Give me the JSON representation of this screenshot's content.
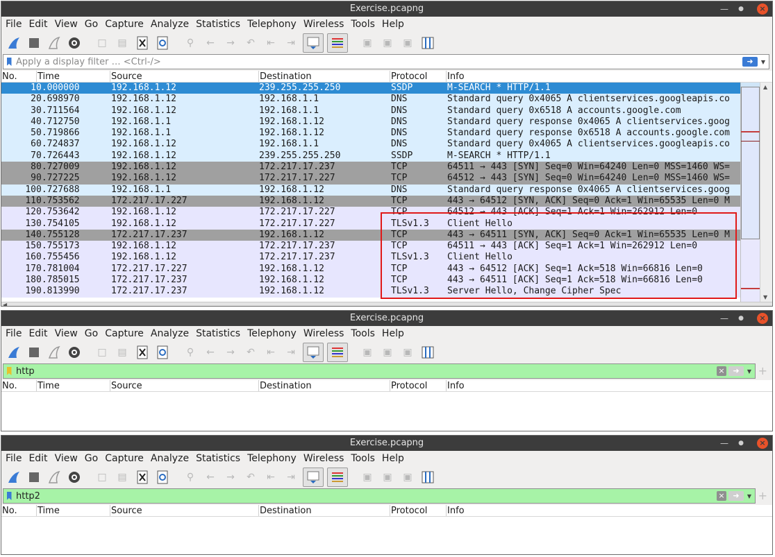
{
  "window_title": "Exercise.pcapng",
  "menu": [
    "File",
    "Edit",
    "View",
    "Go",
    "Capture",
    "Analyze",
    "Statistics",
    "Telephony",
    "Wireless",
    "Tools",
    "Help"
  ],
  "columns": [
    "No.",
    "Time",
    "Source",
    "Destination",
    "Protocol",
    "Info"
  ],
  "panes": [
    {
      "filter_value": "",
      "filter_placeholder": "Apply a display filter … <Ctrl-/>",
      "rows": [
        {
          "no": "1",
          "time": "0.000000",
          "source": "192.168.1.12",
          "destination": "239.255.255.250",
          "protocol": "SSDP",
          "info": "M-SEARCH * HTTP/1.1",
          "kind": "sel"
        },
        {
          "no": "2",
          "time": "0.698970",
          "source": "192.168.1.12",
          "destination": "192.168.1.1",
          "protocol": "DNS",
          "info": "Standard query 0x4065 A clientservices.googleapis.co",
          "kind": "udp"
        },
        {
          "no": "3",
          "time": "0.711564",
          "source": "192.168.1.12",
          "destination": "192.168.1.1",
          "protocol": "DNS",
          "info": "Standard query 0x6518 A accounts.google.com",
          "kind": "udp"
        },
        {
          "no": "4",
          "time": "0.712750",
          "source": "192.168.1.1",
          "destination": "192.168.1.12",
          "protocol": "DNS",
          "info": "Standard query response 0x4065 A clientservices.goog",
          "kind": "udp"
        },
        {
          "no": "5",
          "time": "0.719866",
          "source": "192.168.1.1",
          "destination": "192.168.1.12",
          "protocol": "DNS",
          "info": "Standard query response 0x6518 A accounts.google.com",
          "kind": "udp"
        },
        {
          "no": "6",
          "time": "0.724837",
          "source": "192.168.1.12",
          "destination": "192.168.1.1",
          "protocol": "DNS",
          "info": "Standard query 0x4065 A clientservices.googleapis.co",
          "kind": "udp"
        },
        {
          "no": "7",
          "time": "0.726443",
          "source": "192.168.1.12",
          "destination": "239.255.255.250",
          "protocol": "SSDP",
          "info": "M-SEARCH * HTTP/1.1",
          "kind": "udp"
        },
        {
          "no": "8",
          "time": "0.727009",
          "source": "192.168.1.12",
          "destination": "172.217.17.237",
          "protocol": "TCP",
          "info": "64511 → 443 [SYN] Seq=0 Win=64240 Len=0 MSS=1460 WS=",
          "kind": "tcpbad"
        },
        {
          "no": "9",
          "time": "0.727225",
          "source": "192.168.1.12",
          "destination": "172.217.17.227",
          "protocol": "TCP",
          "info": "64512 → 443 [SYN] Seq=0 Win=64240 Len=0 MSS=1460 WS=",
          "kind": "tcpbad"
        },
        {
          "no": "10",
          "time": "0.727688",
          "source": "192.168.1.1",
          "destination": "192.168.1.12",
          "protocol": "DNS",
          "info": "Standard query response 0x4065 A clientservices.goog",
          "kind": "udp"
        },
        {
          "no": "11",
          "time": "0.753562",
          "source": "172.217.17.227",
          "destination": "192.168.1.12",
          "protocol": "TCP",
          "info": "443 → 64512 [SYN, ACK] Seq=0 Ack=1 Win=65535 Len=0 M",
          "kind": "tcpbad"
        },
        {
          "no": "12",
          "time": "0.753642",
          "source": "192.168.1.12",
          "destination": "172.217.17.227",
          "protocol": "TCP",
          "info": "64512 → 443 [ACK] Seq=1 Ack=1 Win=262912 Len=0",
          "kind": "tcp"
        },
        {
          "no": "13",
          "time": "0.754105",
          "source": "192.168.1.12",
          "destination": "172.217.17.227",
          "protocol": "TLSv1.3",
          "info": "Client Hello",
          "kind": "tcp"
        },
        {
          "no": "14",
          "time": "0.755128",
          "source": "172.217.17.237",
          "destination": "192.168.1.12",
          "protocol": "TCP",
          "info": "443 → 64511 [SYN, ACK] Seq=0 Ack=1 Win=65535 Len=0 M",
          "kind": "tcpbad"
        },
        {
          "no": "15",
          "time": "0.755173",
          "source": "192.168.1.12",
          "destination": "172.217.17.237",
          "protocol": "TCP",
          "info": "64511 → 443 [ACK] Seq=1 Ack=1 Win=262912 Len=0",
          "kind": "tcp"
        },
        {
          "no": "16",
          "time": "0.755456",
          "source": "192.168.1.12",
          "destination": "172.217.17.237",
          "protocol": "TLSv1.3",
          "info": "Client Hello",
          "kind": "tcp"
        },
        {
          "no": "17",
          "time": "0.781004",
          "source": "172.217.17.227",
          "destination": "192.168.1.12",
          "protocol": "TCP",
          "info": "443 → 64512 [ACK] Seq=1 Ack=518 Win=66816 Len=0",
          "kind": "tcp"
        },
        {
          "no": "18",
          "time": "0.785015",
          "source": "172.217.17.237",
          "destination": "192.168.1.12",
          "protocol": "TCP",
          "info": "443 → 64511 [ACK] Seq=1 Ack=518 Win=66816 Len=0",
          "kind": "tcp"
        },
        {
          "no": "19",
          "time": "0.813990",
          "source": "172.217.17.237",
          "destination": "192.168.1.12",
          "protocol": "TLSv1.3",
          "info": "Server Hello, Change Cipher Spec",
          "kind": "tcp"
        }
      ]
    },
    {
      "filter_value": "http",
      "rows": []
    },
    {
      "filter_value": "http2",
      "rows": []
    }
  ],
  "colors": {
    "selected_row": "#2d8bd3",
    "udp_row": "#daeefe",
    "tcp_row": "#e7e6fe",
    "bad_tcp_row": "#a0a0a0",
    "valid_filter": "#a7f3a7",
    "highlight_box": "#e01818",
    "titlebar": "#3c3c3c"
  },
  "toolbar_icons": [
    "shark-fin-icon",
    "stop-icon",
    "restart-icon",
    "options-gear-icon",
    "open-file-icon",
    "save-file-icon",
    "close-file-icon",
    "reload-icon",
    "find-icon",
    "back-icon",
    "forward-icon",
    "goto-icon",
    "first-icon",
    "last-icon",
    "autoscroll-icon",
    "colorize-icon",
    "zoom-in-icon",
    "zoom-out-icon",
    "normal-size-icon",
    "resize-columns-icon"
  ]
}
